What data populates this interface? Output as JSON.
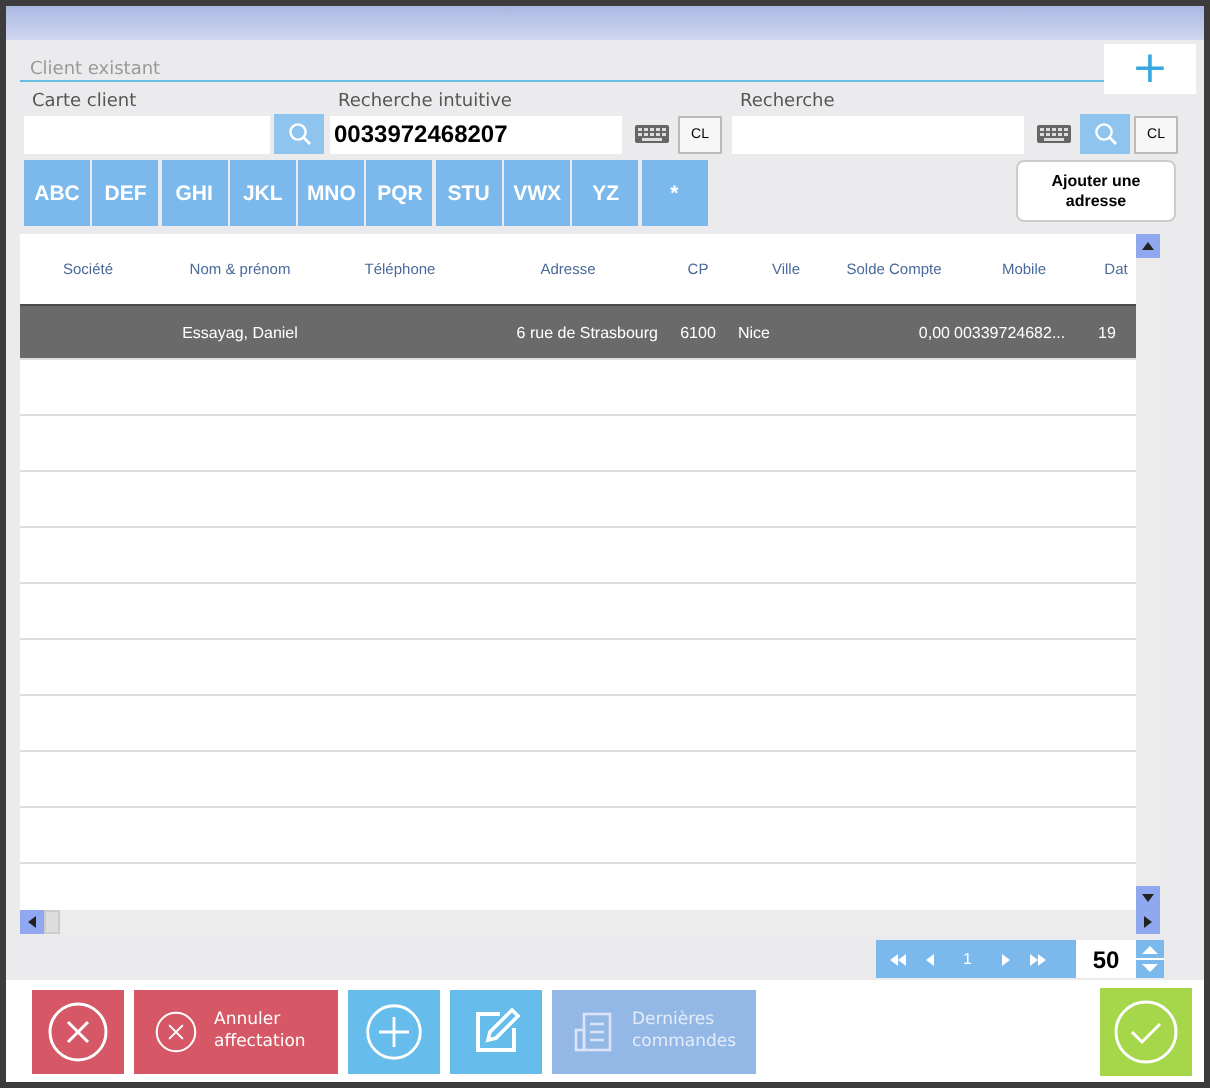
{
  "section_title": "Client existant",
  "add_button": "+",
  "search": {
    "card_label": "Carte client",
    "intuitive_label": "Recherche intuitive",
    "intuitive_value": "0033972468207",
    "search_label": "Recherche",
    "clear_buttons": [
      "CL",
      "CL"
    ]
  },
  "letter_buttons": [
    "ABC",
    "DEF",
    "GHI",
    "JKL",
    "MNO",
    "PQR",
    "STU",
    "VWX",
    "YZ",
    "*"
  ],
  "add_address_button": "Ajouter une adresse",
  "table": {
    "columns": [
      "Société",
      "Nom & prénom",
      "Téléphone",
      "Adresse",
      "CP",
      "Ville",
      "Solde Compte",
      "Mobile",
      "Dat"
    ],
    "rows": [
      {
        "cells": [
          "",
          "Essayag, Daniel",
          "",
          "6 rue de Strasbourg",
          "6100",
          "Nice",
          "0,00",
          "00339724682...",
          "19"
        ],
        "selected": true
      }
    ]
  },
  "pager": {
    "page": "1",
    "page_size": "50"
  },
  "footer_buttons": [
    {
      "kind": "close",
      "color": "#d65766",
      "disabled": false
    },
    {
      "kind": "close",
      "label": "Annuler affectation",
      "color": "#d65766",
      "disabled": false
    },
    {
      "kind": "plus",
      "color": "#66bdeb",
      "disabled": false
    },
    {
      "kind": "edit",
      "color": "#66bdeb",
      "disabled": false
    },
    {
      "kind": "list",
      "label": "Dernières commandes",
      "color": "#93b8e6",
      "disabled": true
    }
  ],
  "confirm_button": {
    "color": "#a6d64a"
  }
}
